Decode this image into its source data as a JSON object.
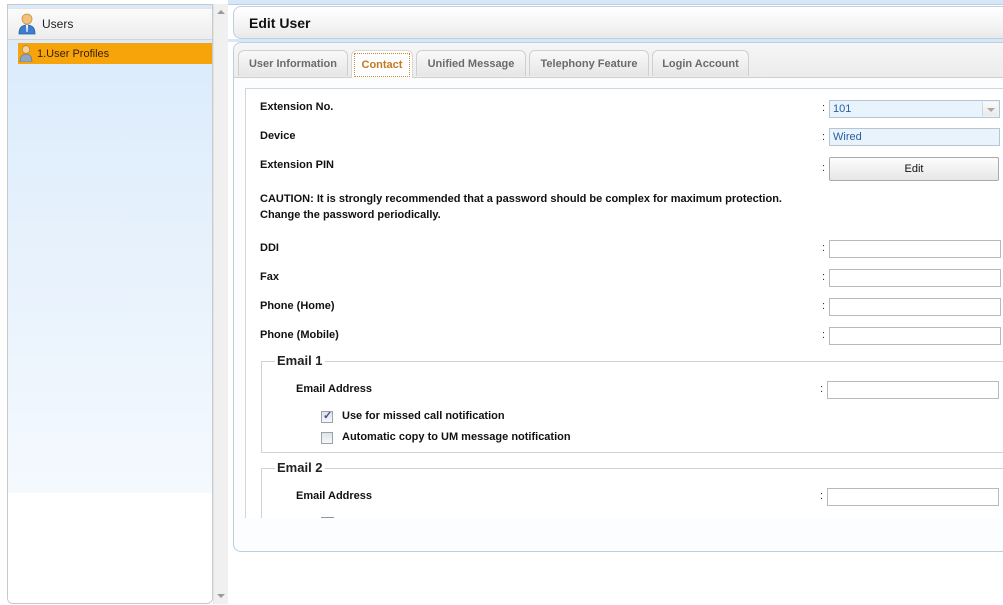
{
  "sidebar": {
    "root_label": "Users",
    "items": [
      {
        "label": "1.User Profiles",
        "selected": true
      }
    ]
  },
  "header": {
    "title": "Edit User"
  },
  "tabs": [
    {
      "label": "User Information",
      "active": false
    },
    {
      "label": "Contact",
      "active": true
    },
    {
      "label": "Unified Message",
      "active": false
    },
    {
      "label": "Telephony Feature",
      "active": false
    },
    {
      "label": "Login Account",
      "active": false
    }
  ],
  "form": {
    "colon": ":",
    "extension_no": {
      "label": "Extension No.",
      "value": "101"
    },
    "device": {
      "label": "Device",
      "value": "Wired"
    },
    "extension_pin": {
      "label": "Extension PIN",
      "button_label": "Edit"
    },
    "caution_line1": "CAUTION: It is strongly recommended that a password should be complex for maximum protection.",
    "caution_line2": "Change the password periodically.",
    "ddi": {
      "label": "DDI",
      "value": ""
    },
    "fax": {
      "label": "Fax",
      "value": ""
    },
    "phone_home": {
      "label": "Phone (Home)",
      "value": ""
    },
    "phone_mobile": {
      "label": "Phone (Mobile)",
      "value": ""
    },
    "email1": {
      "title": "Email 1",
      "address_label": "Email Address",
      "address_value": "",
      "missed_call_label": "Use for missed call notification",
      "missed_call_checked": true,
      "um_copy_label": "Automatic copy to UM message notification",
      "um_copy_checked": false
    },
    "email2": {
      "title": "Email 2",
      "address_label": "Email Address",
      "address_value": ""
    }
  }
}
